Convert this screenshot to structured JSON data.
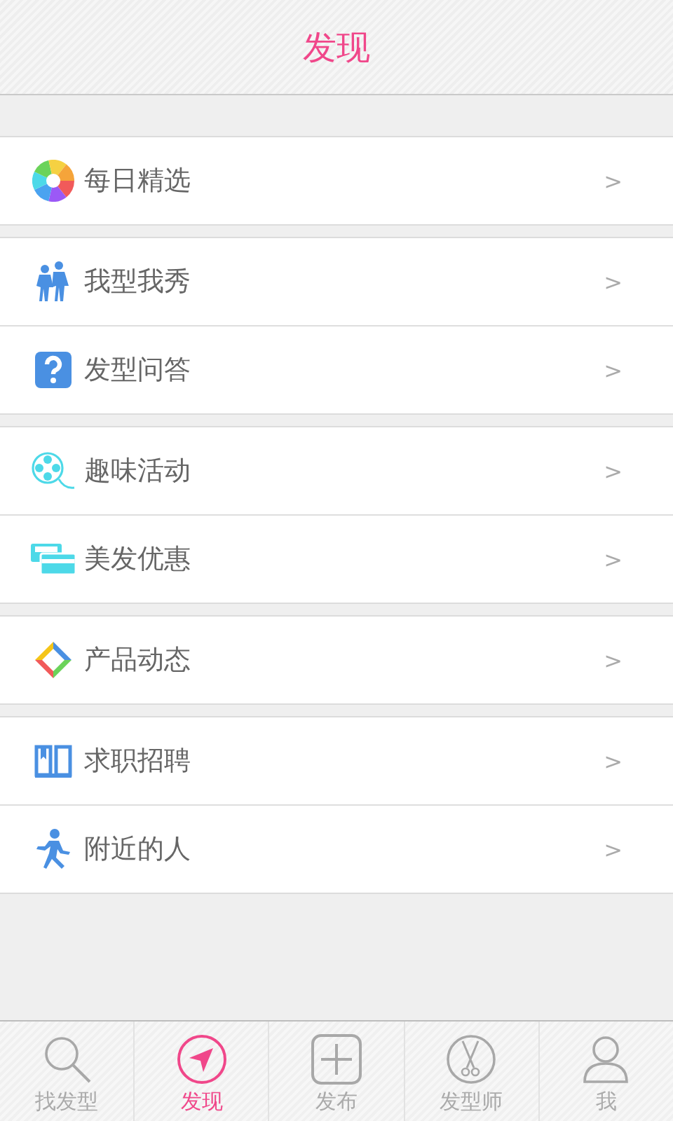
{
  "header": {
    "title": "发现"
  },
  "groups": [
    {
      "items": [
        {
          "label": "每日精选",
          "arrow": ">"
        }
      ]
    },
    {
      "items": [
        {
          "label": "我型我秀",
          "arrow": ">"
        },
        {
          "label": "发型问答",
          "arrow": ">"
        }
      ]
    },
    {
      "items": [
        {
          "label": "趣味活动",
          "arrow": ">"
        },
        {
          "label": "美发优惠",
          "arrow": ">"
        }
      ]
    },
    {
      "items": [
        {
          "label": "产品动态",
          "arrow": ">"
        }
      ]
    },
    {
      "items": [
        {
          "label": "求职招聘",
          "arrow": ">"
        },
        {
          "label": "附近的人",
          "arrow": ">"
        }
      ]
    }
  ],
  "tabs": [
    {
      "label": "找发型",
      "selected": false
    },
    {
      "label": "发现",
      "selected": true
    },
    {
      "label": "发布",
      "selected": false
    },
    {
      "label": "发型师",
      "selected": false
    },
    {
      "label": "我",
      "selected": false
    }
  ]
}
